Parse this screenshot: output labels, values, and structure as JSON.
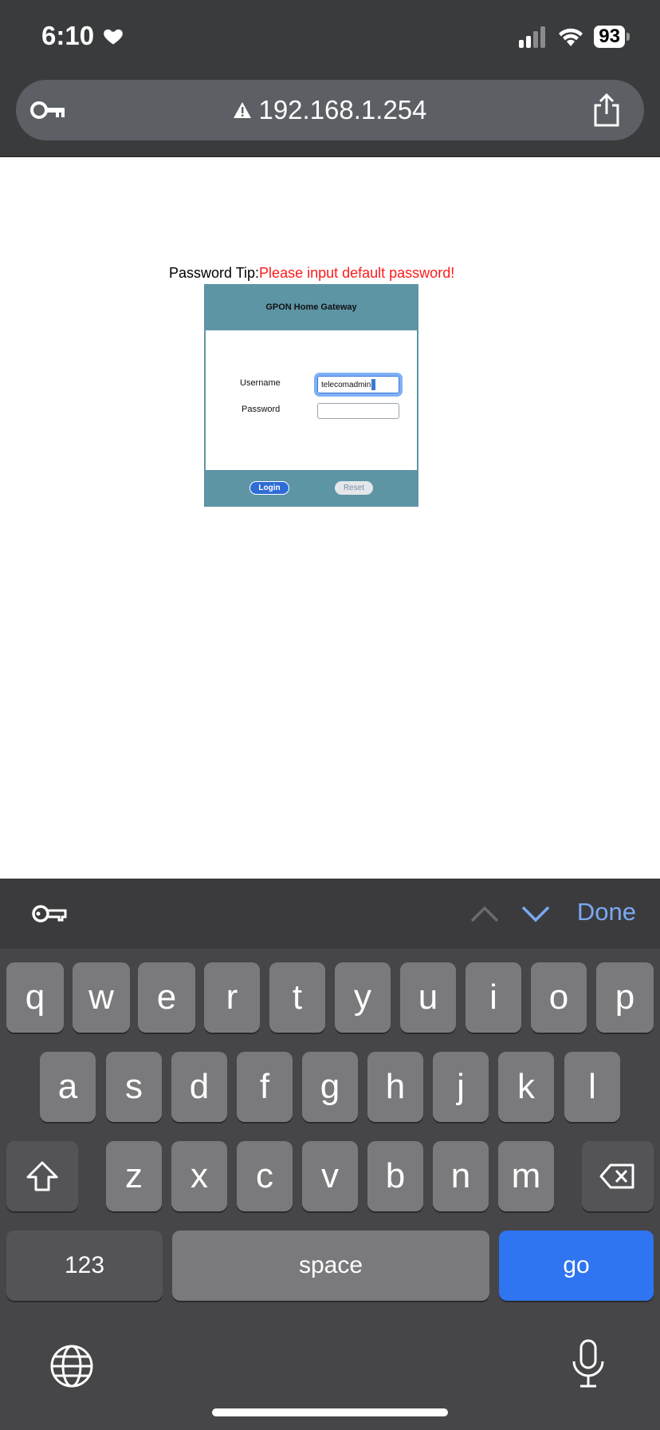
{
  "status_bar": {
    "time": "6:10",
    "battery": "93"
  },
  "browser": {
    "url": "192.168.1.254"
  },
  "page": {
    "tip_label": "Password Tip:",
    "tip_message": "Please input default password!",
    "tip_color": "#ff1a1a",
    "gateway_title": "GPON Home Gateway",
    "username_label": "Username",
    "username_value": "telecomadmin",
    "password_label": "Password",
    "password_value": "",
    "login_label": "Login",
    "reset_label": "Reset",
    "panel_color": "#5d95a5"
  },
  "accessory_bar": {
    "done_label": "Done"
  },
  "keyboard": {
    "row1": [
      "q",
      "w",
      "e",
      "r",
      "t",
      "y",
      "u",
      "i",
      "o",
      "p"
    ],
    "row2": [
      "a",
      "s",
      "d",
      "f",
      "g",
      "h",
      "j",
      "k",
      "l"
    ],
    "row3": [
      "z",
      "x",
      "c",
      "v",
      "b",
      "n",
      "m"
    ],
    "numbers_label": "123",
    "space_label": "space",
    "go_label": "go",
    "go_color": "#2f74f0"
  }
}
